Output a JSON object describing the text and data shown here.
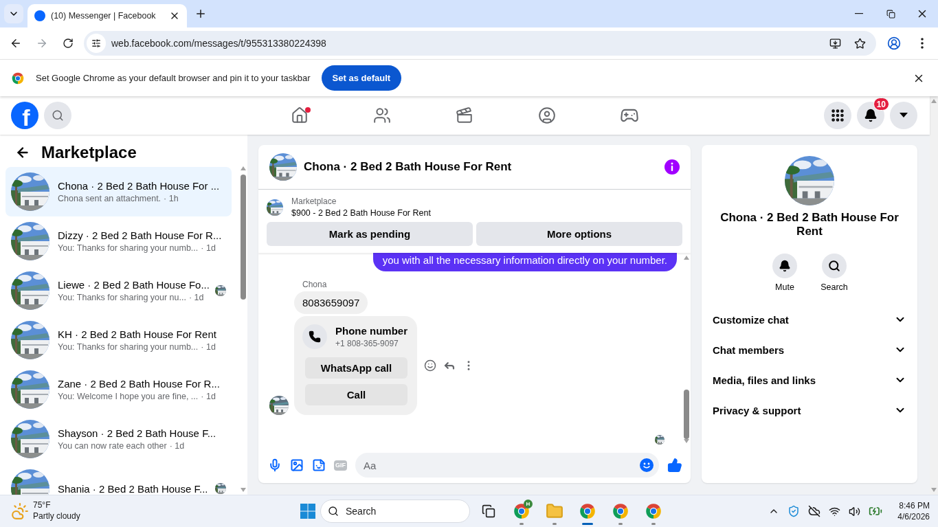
{
  "browser": {
    "tab_title": "(10) Messenger | Facebook",
    "url": "web.facebook.com/messages/t/955313380224398"
  },
  "infobar": {
    "message": "Set Google Chrome as your default browser and pin it to your taskbar",
    "button": "Set as default"
  },
  "nav": {
    "logo_text": "f",
    "items": [
      {
        "kind": "home",
        "selected": false,
        "notification_dot": true
      },
      {
        "kind": "friends",
        "selected": false
      },
      {
        "kind": "reels",
        "selected": false
      },
      {
        "kind": "groups",
        "selected": false
      },
      {
        "kind": "gaming",
        "selected": false
      }
    ],
    "notification_count": "10"
  },
  "sidebar": {
    "title": "Marketplace",
    "conversations": [
      {
        "name": "Chona · 2 Bed 2 Bath House For ...",
        "preview": "Chona sent an attachment.",
        "time": "· 1h",
        "selected": true,
        "seen": false
      },
      {
        "name": "Dizzy · 2 Bed 2 Bath House For R...",
        "preview": "You: Thanks for sharing your numb...",
        "time": "· 1d",
        "selected": false,
        "seen": false
      },
      {
        "name": "Liewe · 2 Bed 2 Bath House Fo...",
        "preview": "You: Thanks for sharing your nu...",
        "time": "· 1d",
        "selected": false,
        "seen": true
      },
      {
        "name": "KH · 2 Bed 2 Bath House For Rent",
        "preview": "You: Thanks for sharing your numb...",
        "time": "· 1d",
        "selected": false,
        "seen": false
      },
      {
        "name": "Zane · 2 Bed 2 Bath House For R...",
        "preview": "You: Welcome I hope you are fine, ...",
        "time": "· 1d",
        "selected": false,
        "seen": false
      },
      {
        "name": "Shayson · 2 Bed 2 Bath House F...",
        "preview": "You can now rate each other",
        "time": "· 1d",
        "selected": false,
        "seen": false
      },
      {
        "name": "Shania · 2 Bed 2 Bath House F...",
        "selected": false,
        "seen": true
      }
    ]
  },
  "chat": {
    "title": "Chona · 2 Bed 2 Bath House For Rent",
    "listing_label": "Marketplace",
    "listing_title": "$900 - 2 Bed 2 Bath House For Rent",
    "listing_buttons": [
      "Mark as pending",
      "More options"
    ],
    "messages": [
      {
        "kind": "outgoing",
        "text": "you with all the necessary information directly on your number."
      },
      {
        "kind": "incoming",
        "sender": "Chona",
        "text": "8083659097",
        "card": {
          "title": "Phone number",
          "subtitle": "+1 808-365-9097",
          "actions": [
            "WhatsApp call",
            "Call"
          ]
        }
      }
    ],
    "seen": true,
    "composer": {
      "placeholder": "Aa",
      "gif_label": "GIF"
    }
  },
  "details": {
    "title": "Chona · 2 Bed 2 Bath House For Rent",
    "actions": [
      {
        "kind": "mute",
        "label": "Mute"
      },
      {
        "kind": "search",
        "label": "Search"
      }
    ],
    "sections": [
      "Customize chat",
      "Chat members",
      "Media, files and links",
      "Privacy & support"
    ]
  },
  "taskbar": {
    "temperature": "75°F",
    "weather": "Partly cloudy",
    "search": "Search",
    "apps": [
      {
        "kind": "taskview"
      },
      {
        "kind": "chrome",
        "badge": "H",
        "selected": false
      },
      {
        "kind": "folder",
        "selected": false
      },
      {
        "kind": "chrome",
        "selected": true
      },
      {
        "kind": "chrome",
        "selected": false
      },
      {
        "kind": "chrome",
        "selected": false
      }
    ],
    "time": "8:46 PM",
    "date": "4/6/2026"
  }
}
